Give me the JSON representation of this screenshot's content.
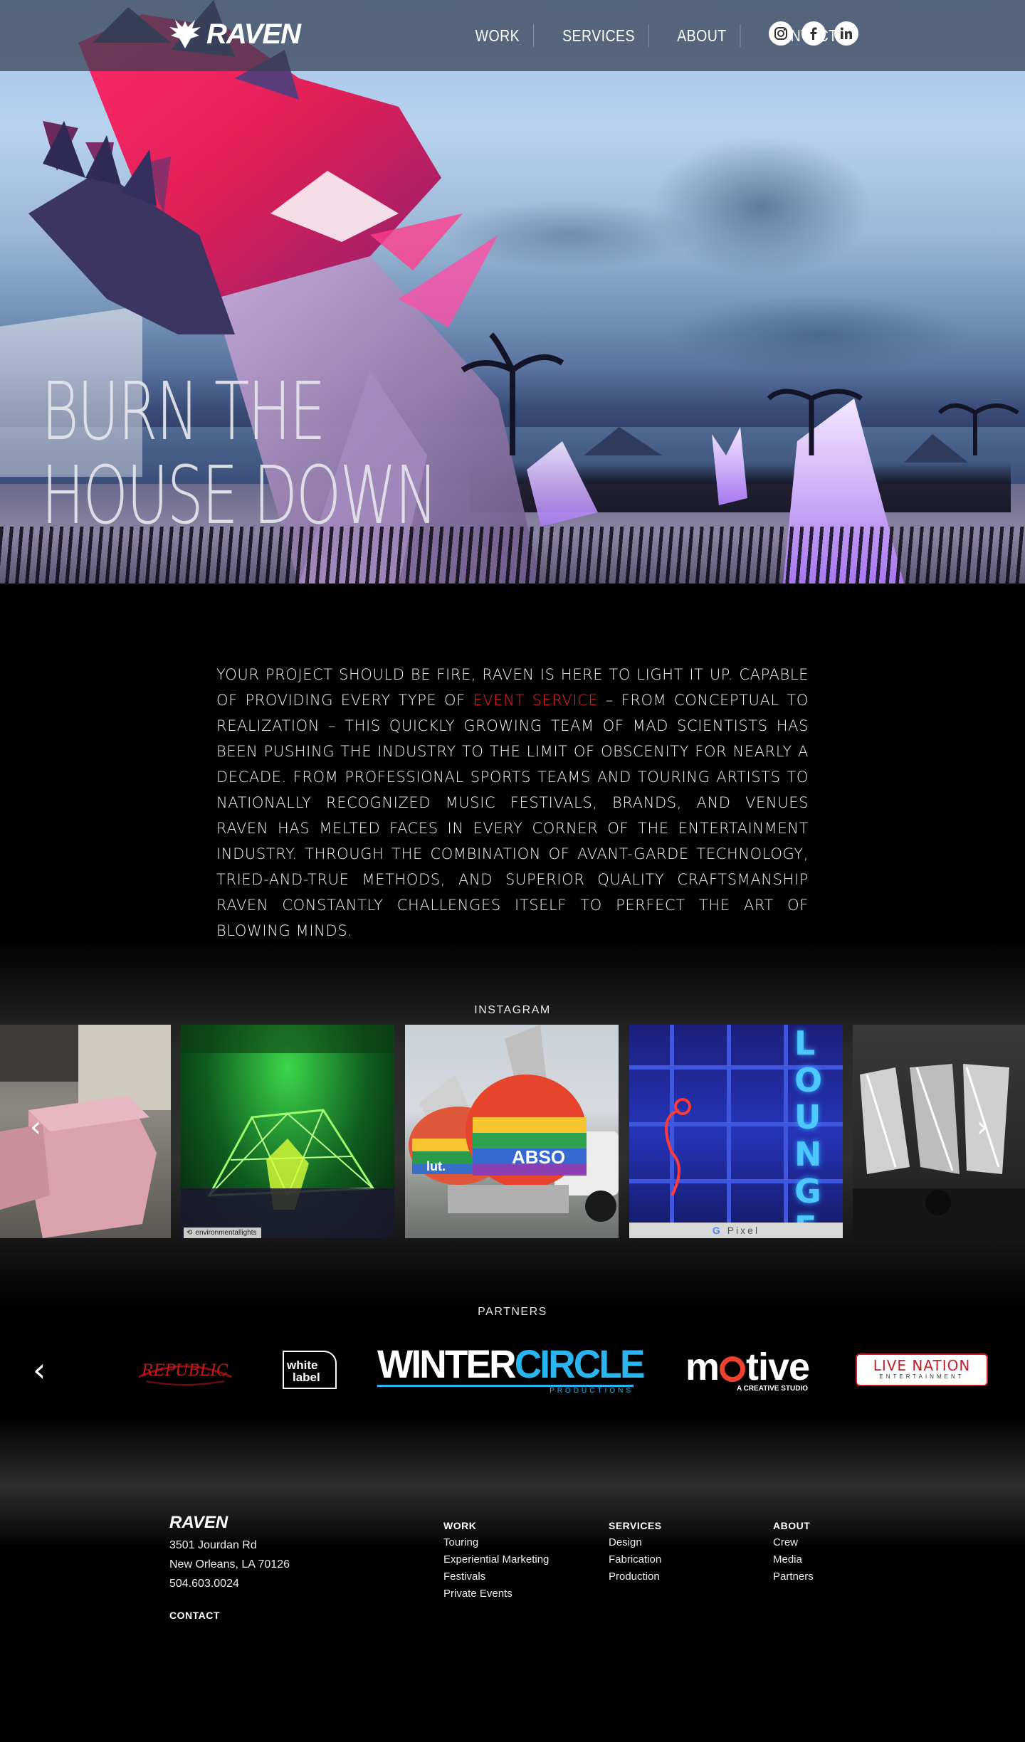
{
  "brand": {
    "name": "RAVEN"
  },
  "nav": {
    "items": [
      {
        "label": "WORK"
      },
      {
        "label": "SERVICES"
      },
      {
        "label": "ABOUT"
      },
      {
        "label": "CONTACT"
      }
    ],
    "socials": [
      "instagram-icon",
      "facebook-icon",
      "linkedin-icon"
    ]
  },
  "hero": {
    "title_line1": "BURN THE",
    "title_line2": "HOUSE DOWN"
  },
  "intro": {
    "before": "YOUR PROJECT SHOULD BE FIRE, RAVEN IS HERE TO LIGHT IT UP. CAPABLE OF PROVIDING EVERY TYPE OF ",
    "link": "EVENT SERVICE",
    "after": " – FROM CONCEPTUAL TO REALIZATION – THIS QUICKLY GROWING TEAM OF MAD SCIENTISTS HAS BEEN PUSHING THE INDUSTRY TO THE LIMIT OF OBSCENITY FOR NEARLY A DECADE. FROM PROFESSIONAL SPORTS TEAMS AND TOURING ARTISTS TO NATIONALLY RECOGNIZED MUSIC FESTIVALS, BRANDS, AND VENUES RAVEN HAS MELTED FACES IN EVERY CORNER OF THE ENTERTAINMENT INDUSTRY. THROUGH THE COMBINATION OF AVANT-GARDE TECHNOLOGY, TRIED-AND-TRUE METHODS, AND SUPERIOR QUALITY CRAFTSMANSHIP RAVEN CONSTANTLY CHALLENGES ITSELF TO PERFECT THE ART OF BLOWING MINDS.",
    "accent_color": "#e8202a"
  },
  "instagram": {
    "label": "INSTAGRAM",
    "tile2_credit": "environmentallights",
    "tile3_tag": "ABSO",
    "tile3_tag2": "lut.",
    "tile4_sign": "LOUNGE",
    "tile4_banner": "Pixel"
  },
  "partners": {
    "label": "PARTNERS",
    "logos": {
      "republic": "REPUBLIC",
      "white_label_1": "white",
      "white_label_2": "label",
      "wintercircle_a": "WINTER",
      "wintercircle_b": "CIRCLE",
      "wintercircle_sub": "PRODUCTIONS",
      "motive_a": "m",
      "motive_b": "tive",
      "motive_sub": "A CREATIVE STUDIO",
      "livenation_a": "LIVE NATION",
      "livenation_sub": "ENTERTAINMENT"
    }
  },
  "footer": {
    "logo": "RAVEN",
    "address_line1": "3501 Jourdan Rd",
    "address_line2": "New Orleans, LA 70126",
    "phone": "504.603.0024",
    "contact": "CONTACT",
    "columns": [
      {
        "head": "WORK",
        "items": [
          "Touring",
          "Experiential Marketing",
          "Festivals",
          "Private Events"
        ]
      },
      {
        "head": "SERVICES",
        "items": [
          "Design",
          "Fabrication",
          "Production"
        ]
      },
      {
        "head": "ABOUT",
        "items": [
          "Crew",
          "Media",
          "Partners"
        ]
      }
    ]
  }
}
